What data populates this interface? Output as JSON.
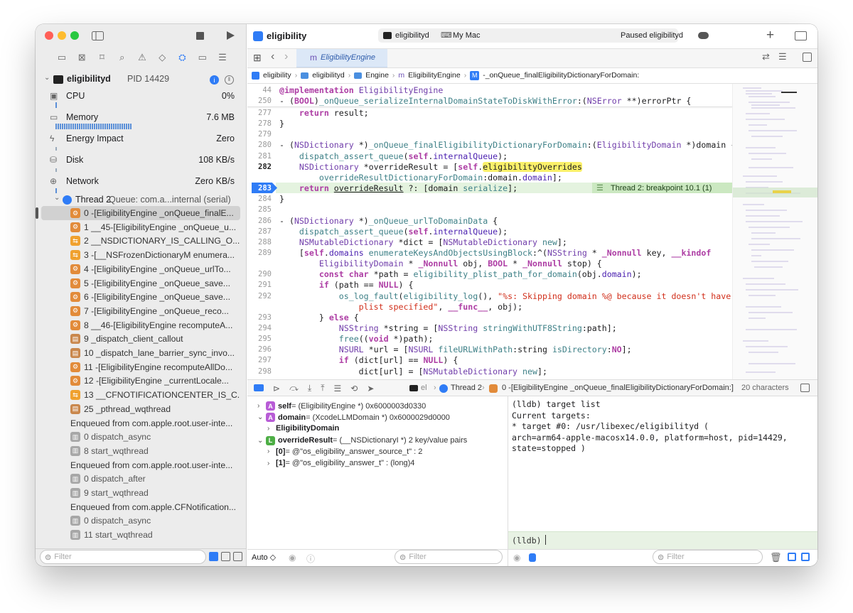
{
  "window": {
    "title": "eligibility"
  },
  "toolbar": {
    "scheme_target": "eligibilityd",
    "destination": "My Mac",
    "status": "Paused eligibilityd"
  },
  "tab": {
    "label": "EligibilityEngine"
  },
  "breadcrumb": [
    "eligibility",
    "eligibilityd",
    "Engine",
    "EligibilityEngine",
    "-_onQueue_finalEligibilityDictionaryForDomain:"
  ],
  "process": {
    "name": "eligibilityd",
    "pid": "PID 14429"
  },
  "gauges": [
    {
      "label": "CPU",
      "value": "0%",
      "icon": "cpu-icon"
    },
    {
      "label": "Memory",
      "value": "7.6 MB",
      "icon": "memory-icon"
    },
    {
      "label": "Energy Impact",
      "value": "Zero",
      "icon": "bolt-icon"
    },
    {
      "label": "Disk",
      "value": "108 KB/s",
      "icon": "disk-icon"
    },
    {
      "label": "Network",
      "value": "Zero KB/s",
      "icon": "network-icon"
    }
  ],
  "thread": {
    "label": "Thread 2",
    "queue": "Queue: com.a...internal (serial)"
  },
  "frames": [
    {
      "text": "0 -[EligibilityEngine _onQueue_finalE...",
      "kind": "u",
      "selected": true
    },
    {
      "text": "1 __45-[EligibilityEngine _onQueue_u...",
      "kind": "u"
    },
    {
      "text": "2 __NSDICTIONARY_IS_CALLING_O...",
      "kind": "sw"
    },
    {
      "text": "3 -[__NSFrozenDictionaryM enumera...",
      "kind": "sw"
    },
    {
      "text": "4 -[EligibilityEngine _onQueue_urlTo...",
      "kind": "u"
    },
    {
      "text": "5 -[EligibilityEngine _onQueue_save...",
      "kind": "u"
    },
    {
      "text": "6 -[EligibilityEngine _onQueue_save...",
      "kind": "u"
    },
    {
      "text": "7 -[EligibilityEngine _onQueue_reco...",
      "kind": "u"
    },
    {
      "text": "8 __46-[EligibilityEngine recomputeA...",
      "kind": "u"
    },
    {
      "text": "9 _dispatch_client_callout",
      "kind": "lib"
    },
    {
      "text": "10 _dispatch_lane_barrier_sync_invo...",
      "kind": "lib"
    },
    {
      "text": "11 -[EligibilityEngine recomputeAllDo...",
      "kind": "u"
    },
    {
      "text": "12 -[EligibilityEngine _currentLocale...",
      "kind": "u"
    },
    {
      "text": "13 __CFNOTIFICATIONCENTER_IS_C...",
      "kind": "sw"
    },
    {
      "text": "25 _pthread_wqthread",
      "kind": "lib"
    },
    {
      "text": "Enqueued from com.apple.root.user-inte...",
      "kind": "enq"
    },
    {
      "text": "0 dispatch_async",
      "kind": "sys"
    },
    {
      "text": "8 start_wqthread",
      "kind": "sys"
    },
    {
      "text": "Enqueued from com.apple.root.user-inte...",
      "kind": "enq"
    },
    {
      "text": "0 dispatch_after",
      "kind": "sys"
    },
    {
      "text": "9 start_wqthread",
      "kind": "sys"
    },
    {
      "text": "Enqueued from com.apple.CFNotification...",
      "kind": "enq"
    },
    {
      "text": "0 dispatch_async",
      "kind": "sys"
    },
    {
      "text": "11 start_wqthread",
      "kind": "sys"
    }
  ],
  "sidebar_filter": {
    "placeholder": "Filter"
  },
  "sticky_header": [
    {
      "num": "44",
      "html": "<span class=\"kw\">@implementation</span> <span class=\"ty\">EligibilityEngine</span>"
    },
    {
      "num": "250",
      "html": "- (<span class=\"kw\">BOOL</span>)<span class=\"fn\">_onQueue_serializeInternalDomainStateToDiskWithError</span>:(<span class=\"ty\">NSError</span> **)errorPtr {"
    }
  ],
  "code": [
    {
      "num": "277",
      "html": "    <span class=\"kw\">return</span> result;"
    },
    {
      "num": "278",
      "html": "}"
    },
    {
      "num": "279",
      "html": ""
    },
    {
      "num": "280",
      "html": "- (<span class=\"ty\">NSDictionary</span> *)<span class=\"fn\">_onQueue_finalEligibilityDictionaryForDomain</span>:(<span class=\"ty\">EligibilityDomain</span> *)domain {"
    },
    {
      "num": "281",
      "html": "    <span class=\"fn\">dispatch_assert_queue</span>(<span class=\"kw\">self</span>.<span class=\"mem\">internalQueue</span>);"
    },
    {
      "num": "282",
      "html": "    <span class=\"ty\">NSDictionary</span> *overrideResult = [<span class=\"kw\">self</span>.<span style=\"background:#fbf06a;border-radius:3px\">eligibilityOverrides</span>",
      "bold": true
    },
    {
      "num": "",
      "html": "        <span class=\"fn\">overrideResultDictionaryForDomain</span>:domain.<span class=\"mem\">domain</span>];"
    },
    {
      "num": "283",
      "html": "    <span class=\"kw\">return</span> <span style=\"text-decoration:underline\">overrideResult</span> ?: [domain <span class=\"fn\">serialize</span>];",
      "current": true
    },
    {
      "num": "284",
      "html": "}"
    },
    {
      "num": "285",
      "html": ""
    },
    {
      "num": "286",
      "html": "- (<span class=\"ty\">NSDictionary</span> *)<span class=\"fn\">_onQueue_urlToDomainData</span> {"
    },
    {
      "num": "287",
      "html": "    <span class=\"fn\">dispatch_assert_queue</span>(<span class=\"kw\">self</span>.<span class=\"mem\">internalQueue</span>);"
    },
    {
      "num": "288",
      "html": "    <span class=\"ty\">NSMutableDictionary</span> *dict = [<span class=\"ty\">NSMutableDictionary</span> <span class=\"fn\">new</span>];"
    },
    {
      "num": "289",
      "html": "    [<span class=\"kw\">self</span>.<span class=\"mem\">domains</span> <span class=\"fn\">enumerateKeysAndObjectsUsingBlock</span>:^(<span class=\"ty\">NSString</span> * <span class=\"kw\">_Nonnull</span> key, <span class=\"kw\">__kindof</span>"
    },
    {
      "num": "",
      "html": "        <span class=\"ty\">EligibilityDomain</span> * <span class=\"kw\">_Nonnull</span> obj, <span class=\"kw\">BOOL</span> * <span class=\"kw\">_Nonnull</span> stop) {"
    },
    {
      "num": "290",
      "html": "        <span class=\"kw\">const char</span> *path = <span class=\"fn\">eligibility_plist_path_for_domain</span>(obj.<span class=\"mem\">domain</span>);"
    },
    {
      "num": "291",
      "html": "        <span class=\"kw\">if</span> (path == <span class=\"kw\">NULL</span>) {"
    },
    {
      "num": "292",
      "html": "            <span class=\"fn\">os_log_fault</span>(<span class=\"fn\">eligibility_log</span>(), <span class=\"str\">\"%s: Skipping domain %@ because it doesn't have a</span>"
    },
    {
      "num": "",
      "html": "<span class=\"str\">                plist specified\"</span>, <span class=\"kw\">__func__</span>, obj);"
    },
    {
      "num": "293",
      "html": "        } <span class=\"kw\">else</span> {"
    },
    {
      "num": "294",
      "html": "            <span class=\"ty\">NSString</span> *string = [<span class=\"ty\">NSString</span> <span class=\"fn\">stringWithUTF8String</span>:path];"
    },
    {
      "num": "295",
      "html": "            <span class=\"fn\">free</span>((<span class=\"kw\">void</span> *)path);"
    },
    {
      "num": "296",
      "html": "            <span class=\"ty\">NSURL</span> *url = [<span class=\"ty\">NSURL</span> <span class=\"fn\">fileURLWithPath</span>:string <span class=\"fn\">isDirectory</span>:<span class=\"kw\">NO</span>];"
    },
    {
      "num": "297",
      "html": "            <span class=\"kw\">if</span> (dict[url] == <span class=\"kw\">NULL</span>) {"
    },
    {
      "num": "298",
      "html": "                dict[url] = [<span class=\"ty\">NSMutableDictionary</span> <span class=\"fn\">new</span>];"
    }
  ],
  "breakpoint_annotation": "Thread 2: breakpoint 10.1 (1)",
  "debug_bar": {
    "process_short": "el",
    "thread": "Thread 2",
    "frame": "0 -[EligibilityEngine _onQueue_finalEligibilityDictionaryForDomain:]",
    "chars": "20 characters"
  },
  "variables": [
    {
      "indent": 0,
      "arrow": "›",
      "badge": "A",
      "badgeColor": "#b85cd6",
      "name": "self",
      "rest": " = (EligibilityEngine *) 0x6000003d0330"
    },
    {
      "indent": 0,
      "arrow": "⌄",
      "badge": "A",
      "badgeColor": "#b85cd6",
      "name": "domain",
      "rest": " = (XcodeLLMDomain *) 0x6000029d0000"
    },
    {
      "indent": 1,
      "arrow": "›",
      "badge": "",
      "badgeColor": "",
      "name": "EligibilityDomain",
      "rest": ""
    },
    {
      "indent": 0,
      "arrow": "⌄",
      "badge": "L",
      "badgeColor": "#4dae45",
      "name": "overrideResult",
      "rest": " = (__NSDictionaryI *) 2 key/value pairs"
    },
    {
      "indent": 1,
      "arrow": "›",
      "badge": "",
      "badgeColor": "",
      "name": "[0]",
      "rest": " = @\"os_eligibility_answer_source_t\" : 2"
    },
    {
      "indent": 1,
      "arrow": "›",
      "badge": "",
      "badgeColor": "",
      "name": "[1]",
      "rest": " = @\"os_eligibility_answer_t\" : (long)4"
    }
  ],
  "console": {
    "output": "(lldb) target list\nCurrent targets:\n* target #0: /usr/libexec/eligibilityd (\narch=arm64-apple-macosx14.0.0, platform=host, pid=14429,\nstate=stopped )",
    "prompt": "(lldb)"
  },
  "vars_footer": {
    "scope": "Auto ◇",
    "filter": "Filter"
  },
  "console_footer": {
    "filter": "Filter"
  }
}
